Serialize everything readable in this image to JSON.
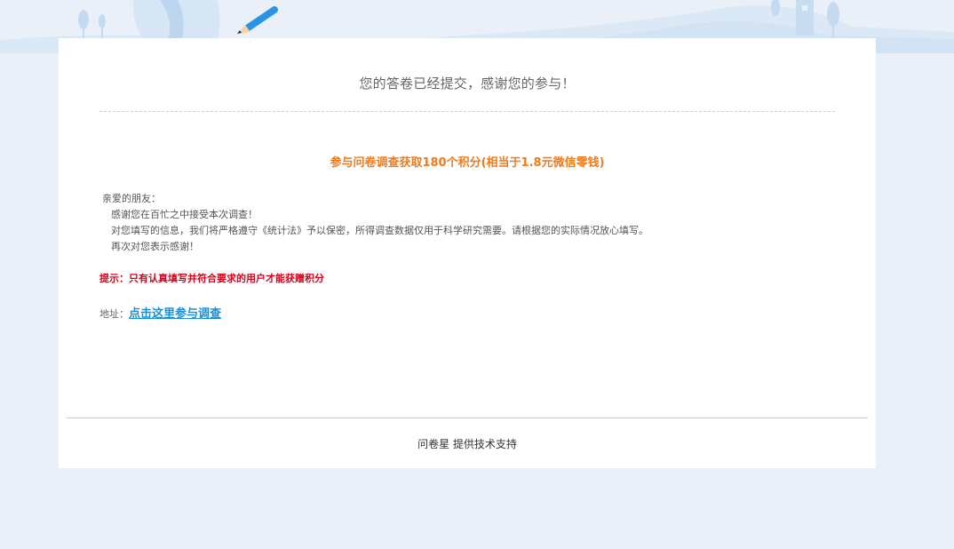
{
  "title": "您的答卷已经提交，感谢您的参与！",
  "promo": "参与问卷调查获取180个积分(相当于1.8元微信零钱)",
  "letter": {
    "greeting": "亲爱的朋友：",
    "lines": [
      "感谢您在百忙之中接受本次调查！",
      "对您填写的信息，我们将严格遵守《统计法》予以保密，所得调查数据仅用于科学研究需要。请根据您的实际情况放心填写。",
      "再次对您表示感谢！"
    ]
  },
  "hint": "提示：只有认真填写并符合要求的用户才能获赠积分",
  "address": {
    "label": "地址：",
    "link_text": "点击这里参与调查"
  },
  "footer": {
    "brand": "问卷星",
    "text": " 提供技术支持"
  },
  "colors": {
    "background": "#eaf0f8",
    "promo": "#f07b1d",
    "hint": "#d9001b",
    "link": "#1a8ed6"
  }
}
